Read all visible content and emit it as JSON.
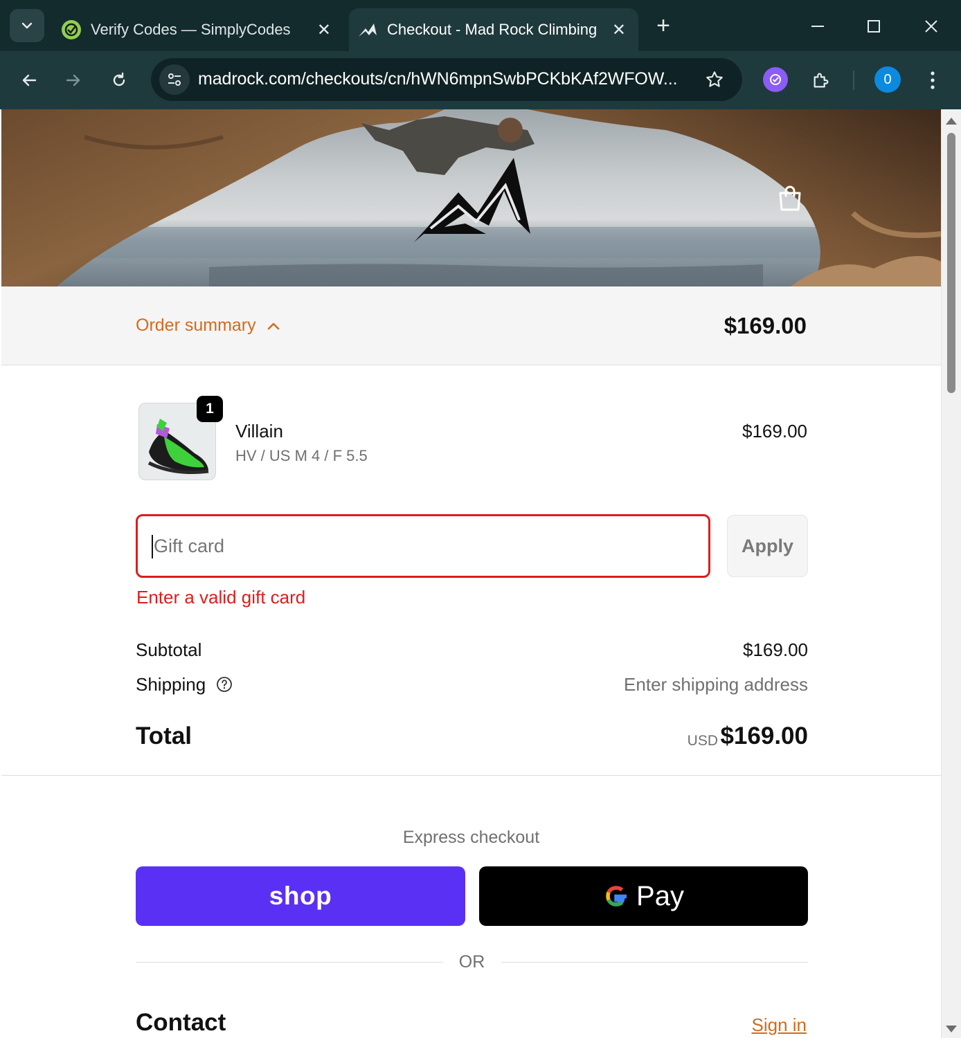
{
  "browser": {
    "tabs": [
      {
        "title": "Verify Codes — SimplyCodes",
        "active": false,
        "icon": "simplycodes-icon"
      },
      {
        "title": "Checkout - Mad Rock Climbing",
        "active": true,
        "icon": "madrock-logo-icon"
      }
    ],
    "url": "madrock.com/checkouts/cn/hWN6mpnSwbPCKbKAf2WFOW...",
    "profile_initial": "0"
  },
  "summary": {
    "toggle_label": "Order summary",
    "total": "$169.00"
  },
  "line_item": {
    "quantity": "1",
    "name": "Villain",
    "variant": "HV / US M 4 / F 5.5",
    "price": "$169.00"
  },
  "gift_card": {
    "placeholder": "Gift card",
    "apply_label": "Apply",
    "error": "Enter a valid gift card"
  },
  "totals": {
    "subtotal_label": "Subtotal",
    "subtotal_value": "$169.00",
    "shipping_label": "Shipping",
    "shipping_value": "Enter shipping address",
    "total_label": "Total",
    "currency": "USD",
    "total_value": "$169.00"
  },
  "express": {
    "title": "Express checkout",
    "shop_label": "shop",
    "gpay_label": "Pay",
    "or_label": "OR"
  },
  "contact": {
    "title": "Contact",
    "signin_label": "Sign in"
  },
  "colors": {
    "accent": "#d36b1c",
    "error": "#dd1d1d",
    "shop_pay": "#5a31f4",
    "chrome_bg": "#1f3a3d"
  }
}
